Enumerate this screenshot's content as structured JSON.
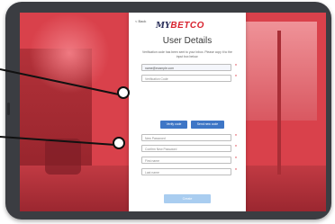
{
  "screen": {
    "back_label": "< Back",
    "logo": {
      "prefix": "MY",
      "brand": "BETCO"
    },
    "title": "User Details",
    "instructions": "Verification code has been sent to your inbox. Please copy it to the input box below.",
    "email_value": "name@example.com",
    "verification_code_placeholder": "Verification Code",
    "verify_button": "Verify code",
    "resend_button": "Send new code",
    "new_password_placeholder": "New Password",
    "confirm_password_placeholder": "Confirm New Password",
    "first_name_placeholder": "First name",
    "last_name_placeholder": "Last name",
    "submit_button": "Create"
  },
  "colors": {
    "background_tint": "#d9414b",
    "brand_red": "#d8222e",
    "button_blue": "#3e76c6",
    "submit_disabled": "#a9cdf0"
  }
}
